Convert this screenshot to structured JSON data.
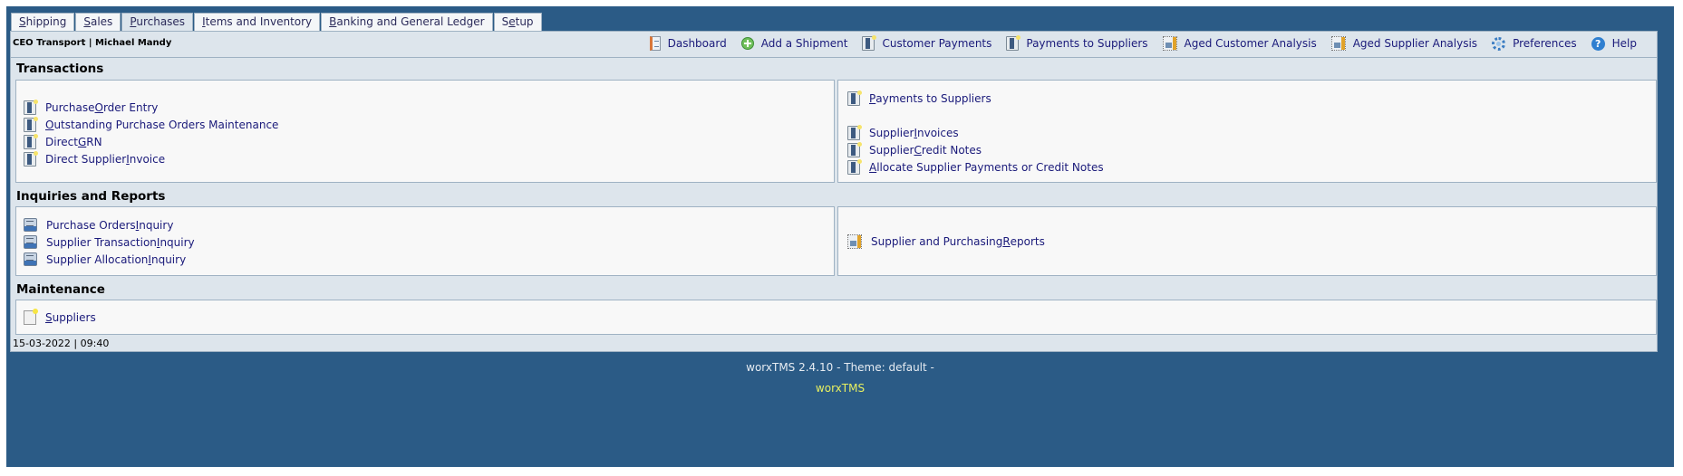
{
  "tabs": [
    {
      "pre": "",
      "ul": "S",
      "post": "hipping"
    },
    {
      "pre": "",
      "ul": "S",
      "post": "ales"
    },
    {
      "pre": "",
      "ul": "P",
      "post": "urchases"
    },
    {
      "pre": "",
      "ul": "I",
      "post": "tems and Inventory"
    },
    {
      "pre": "",
      "ul": "B",
      "post": "anking and General Ledger"
    },
    {
      "pre": "S",
      "ul": "e",
      "post": "tup"
    }
  ],
  "active_tab": "Purchases",
  "header": {
    "company_user": "CEO Transport | Michael Mandy",
    "quick_links": [
      {
        "label": "Dashboard",
        "icon": "dashboard-icon"
      },
      {
        "label": "Add a Shipment",
        "icon": "add-icon"
      },
      {
        "label": "Customer Payments",
        "icon": "book-icon"
      },
      {
        "label": "Payments to Suppliers",
        "icon": "book-icon"
      },
      {
        "label": "Aged Customer Analysis",
        "icon": "report-icon"
      },
      {
        "label": "Aged Supplier Analysis",
        "icon": "report-icon"
      },
      {
        "label": "Preferences",
        "icon": "gear-icon"
      },
      {
        "label": "Help",
        "icon": "help-icon"
      }
    ]
  },
  "sections": {
    "transactions": {
      "title": "Transactions",
      "left": [
        {
          "pre": "Purchase ",
          "ul": "O",
          "post": "rder Entry"
        },
        {
          "pre": "",
          "ul": "O",
          "post": "utstanding Purchase Orders Maintenance"
        },
        {
          "pre": "Direct ",
          "ul": "G",
          "post": "RN"
        },
        {
          "pre": "Direct Supplier ",
          "ul": "I",
          "post": "nvoice"
        }
      ],
      "right": [
        {
          "pre": "",
          "ul": "P",
          "post": "ayments to Suppliers"
        },
        {
          "pre": "Supplier ",
          "ul": "I",
          "post": "nvoices"
        },
        {
          "pre": "Supplier ",
          "ul": "C",
          "post": "redit Notes"
        },
        {
          "pre": "",
          "ul": "A",
          "post": "llocate Supplier Payments or Credit Notes"
        }
      ]
    },
    "inquiries": {
      "title": "Inquiries and Reports",
      "left": [
        {
          "pre": "Purchase Orders ",
          "ul": "I",
          "post": "nquiry"
        },
        {
          "pre": "Supplier Transaction ",
          "ul": "I",
          "post": "nquiry"
        },
        {
          "pre": "Supplier Allocation ",
          "ul": "I",
          "post": "nquiry"
        }
      ],
      "right": [
        {
          "pre": "Supplier and Purchasing ",
          "ul": "R",
          "post": "eports"
        }
      ]
    },
    "maintenance": {
      "title": "Maintenance",
      "items": [
        {
          "pre": "",
          "ul": "S",
          "post": "uppliers"
        }
      ]
    }
  },
  "footer": {
    "datetime": "15-03-2022 | 09:40",
    "version": "worxTMS 2.4.10 - Theme: default -",
    "brand": "worxTMS"
  },
  "colors": {
    "outer_bg": "#2b5b86",
    "content_bg": "#dde5ec",
    "panel_bg": "#f8f8f8",
    "link": "#1a1a7a",
    "brand": "#e8f060"
  }
}
